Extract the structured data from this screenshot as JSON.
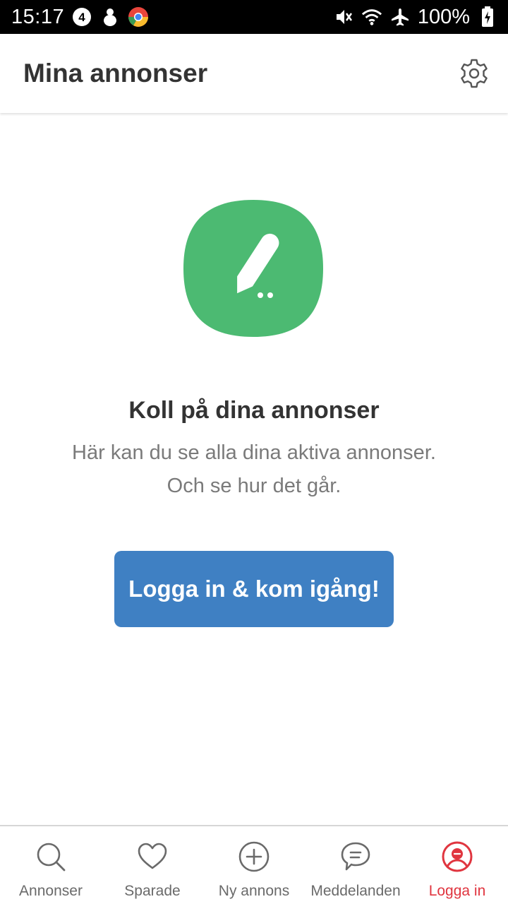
{
  "status_bar": {
    "time": "15:17",
    "battery": "100%",
    "icons": [
      "channel4-icon",
      "bug-icon",
      "chrome-icon",
      "mute-icon",
      "wifi-icon",
      "airplane-icon",
      "battery-charging-icon"
    ]
  },
  "header": {
    "title": "Mina annonser",
    "settings_icon": "gear-icon"
  },
  "empty_state": {
    "icon": "pencil-icon",
    "icon_color": "#4cba72",
    "title": "Koll på dina annonser",
    "description_line1": "Här kan du se alla dina aktiva annonser.",
    "description_line2": "Och se hur det går.",
    "button_label": "Logga in & kom igång!",
    "button_color": "#3f80c3"
  },
  "bottom_nav": {
    "active_color": "#e0353f",
    "items": [
      {
        "label": "Annonser",
        "icon": "search-icon"
      },
      {
        "label": "Sparade",
        "icon": "heart-icon"
      },
      {
        "label": "Ny annons",
        "icon": "plus-circle-icon"
      },
      {
        "label": "Meddelanden",
        "icon": "chat-icon"
      },
      {
        "label": "Logga in",
        "icon": "user-icon",
        "active": true
      }
    ]
  }
}
